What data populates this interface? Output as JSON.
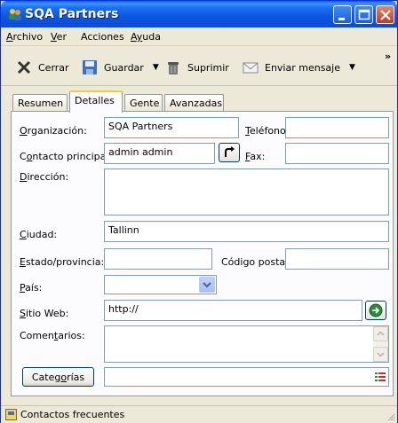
{
  "window": {
    "title": "SQA Partners"
  },
  "menu": [
    {
      "label": "Archivo",
      "mnemonic": "A",
      "rest": "rchivo"
    },
    {
      "label": "Ver",
      "mnemonic": "V",
      "rest": "er"
    },
    {
      "label": "Acciones",
      "mnemonic": "",
      "rest": "Acciones"
    },
    {
      "label": "Ayuda",
      "mnemonic": "Ay",
      "rest": "uda"
    }
  ],
  "toolbar": {
    "close_label": "Cerrar",
    "save_label": "Guardar",
    "delete_label": "Suprimir",
    "send_label": "Enviar mensaje",
    "overflow": "»"
  },
  "tabs": [
    {
      "label": "Resumen",
      "active": false
    },
    {
      "label": "Detalles",
      "active": true
    },
    {
      "label": "Gente",
      "active": false
    },
    {
      "label": "Avanzadas",
      "active": false
    }
  ],
  "form": {
    "organization_label_u": "O",
    "organization_label_rest": "rganización:",
    "organization_value": "SQA Partners",
    "phone_label_u": "T",
    "phone_label_rest": "eléfono:",
    "phone_value": "",
    "contact_label_pre": "C",
    "contact_label_u": "o",
    "contact_label_rest": "ntacto principal:",
    "contact_value": "admin admin",
    "fax_label_u": "F",
    "fax_label_rest": "ax:",
    "fax_value": "",
    "address_label_u": "D",
    "address_label_rest": "irección:",
    "address_value": "",
    "city_label_u": "C",
    "city_label_rest": "iudad:",
    "city_value": "Tallinn",
    "state_label_u": "E",
    "state_label_rest": "stado/provincia:",
    "state_value": "",
    "postal_label_pre": "Código posta",
    "postal_label_u": "l",
    "postal_label_rest": ":",
    "postal_value": "",
    "country_label_u": "P",
    "country_label_rest": "aís:",
    "country_value": "",
    "website_label_u": "S",
    "website_label_rest": "itio Web:",
    "website_value": "http://",
    "comments_label_pre": "Comen",
    "comments_label_u": "t",
    "comments_label_rest": "arios:",
    "comments_value": "",
    "categories_button_pre": "Categ",
    "categories_button_u": "o",
    "categories_button_rest": "rías",
    "categories_value": ""
  },
  "status": {
    "text": "Contactos frecuentes"
  },
  "colors": {
    "title_bar": "#0b56e0",
    "window_bg": "#ece9d8",
    "field_border": "#7f9db9",
    "tab_highlight": "#ffc83c"
  }
}
